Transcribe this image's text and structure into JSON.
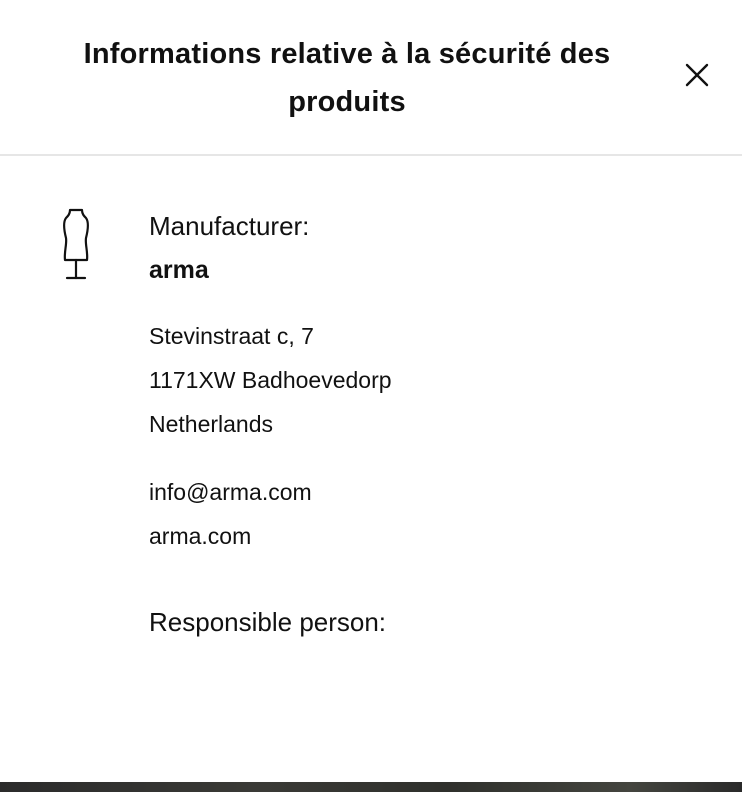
{
  "modal": {
    "title": "Informations relative à la sécurité des produits",
    "close_icon": "close-icon"
  },
  "manufacturer": {
    "icon": "mannequin-icon",
    "label": "Manufacturer:",
    "name": "arma",
    "address_lines": [
      "Stevinstraat c, 7",
      "1171XW Badhoevedorp",
      "Netherlands"
    ],
    "email": "info@arma.com",
    "website": "arma.com"
  },
  "responsible_person": {
    "label": "Responsible person:"
  }
}
